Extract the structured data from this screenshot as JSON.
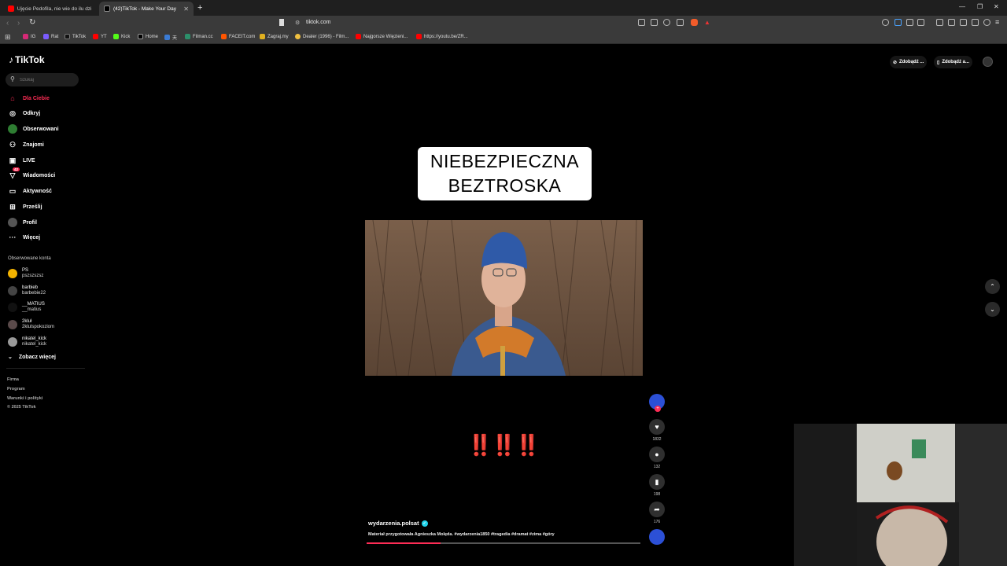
{
  "browser": {
    "tabs": [
      {
        "title": "Ujęcie Pedofila, nie wie do ilu dzieci",
        "active": false
      },
      {
        "title": "(42)TikTok - Make Your Day",
        "active": true
      }
    ],
    "new_tab": "+",
    "url": "tiktok.com",
    "bookmarks": [
      "IG",
      "Rat",
      "TikTok",
      "YT",
      "Kick",
      "Home",
      "天",
      "Filman.cc",
      "FACEIT.com",
      "Zagraj.my",
      "Dealer (1996) - Film...",
      "Najgorsze Więzieni...",
      "https://youtu.be/ZR..."
    ]
  },
  "tiktok": {
    "logo": "TikTok",
    "search_placeholder": "Szukaj",
    "nav": [
      {
        "label": "Dla Ciebie",
        "icon": "home-icon",
        "active": true
      },
      {
        "label": "Odkryj",
        "icon": "compass-icon"
      },
      {
        "label": "Obserwowani",
        "icon": "following-icon"
      },
      {
        "label": "Znajomi",
        "icon": "friends-icon"
      },
      {
        "label": "LIVE",
        "icon": "live-icon"
      },
      {
        "label": "Wiadomości",
        "icon": "messages-icon",
        "badge": "42"
      },
      {
        "label": "Aktywność",
        "icon": "activity-icon"
      },
      {
        "label": "Prześlij",
        "icon": "upload-icon"
      },
      {
        "label": "Profil",
        "icon": "profile-icon"
      },
      {
        "label": "Więcej",
        "icon": "more-icon"
      }
    ],
    "followed_title": "Obserwowane konta",
    "followed": [
      {
        "name": "PS",
        "handle": "pszszszsz"
      },
      {
        "name": "barbieb",
        "handle": "barbebie22"
      },
      {
        "name": "__MATIUS",
        "handle": "__matius"
      },
      {
        "name": "2kluł",
        "handle": "2klulspokoziom"
      },
      {
        "name": "nikatel_kick",
        "handle": "nikatel_kick"
      }
    ],
    "see_more": "Zobacz więcej",
    "footer": [
      "Firma",
      "Program",
      "Warunki i polityki",
      "© 2025 TikTok"
    ],
    "top_actions": [
      "Zdobądź ...",
      "Zdobądź a..."
    ]
  },
  "video": {
    "caption_line1": "NIEBEZPIECZNA",
    "caption_line2": "BEZTROSKA",
    "exclaims": "‼️‼️‼️",
    "author": "wydarzenia.polsat",
    "description": "Materiał przygotowała Agnieszka Molęda. #wydarzenia1850 #tragedia #dramat #zima #góry",
    "progress": 0.27,
    "likes": "1832",
    "comments": "132",
    "saves": "198",
    "shares": "176"
  },
  "colors": {
    "accent": "#fe2c55",
    "caption_bg": "#ffffff",
    "exclaim": "#e8121a"
  }
}
